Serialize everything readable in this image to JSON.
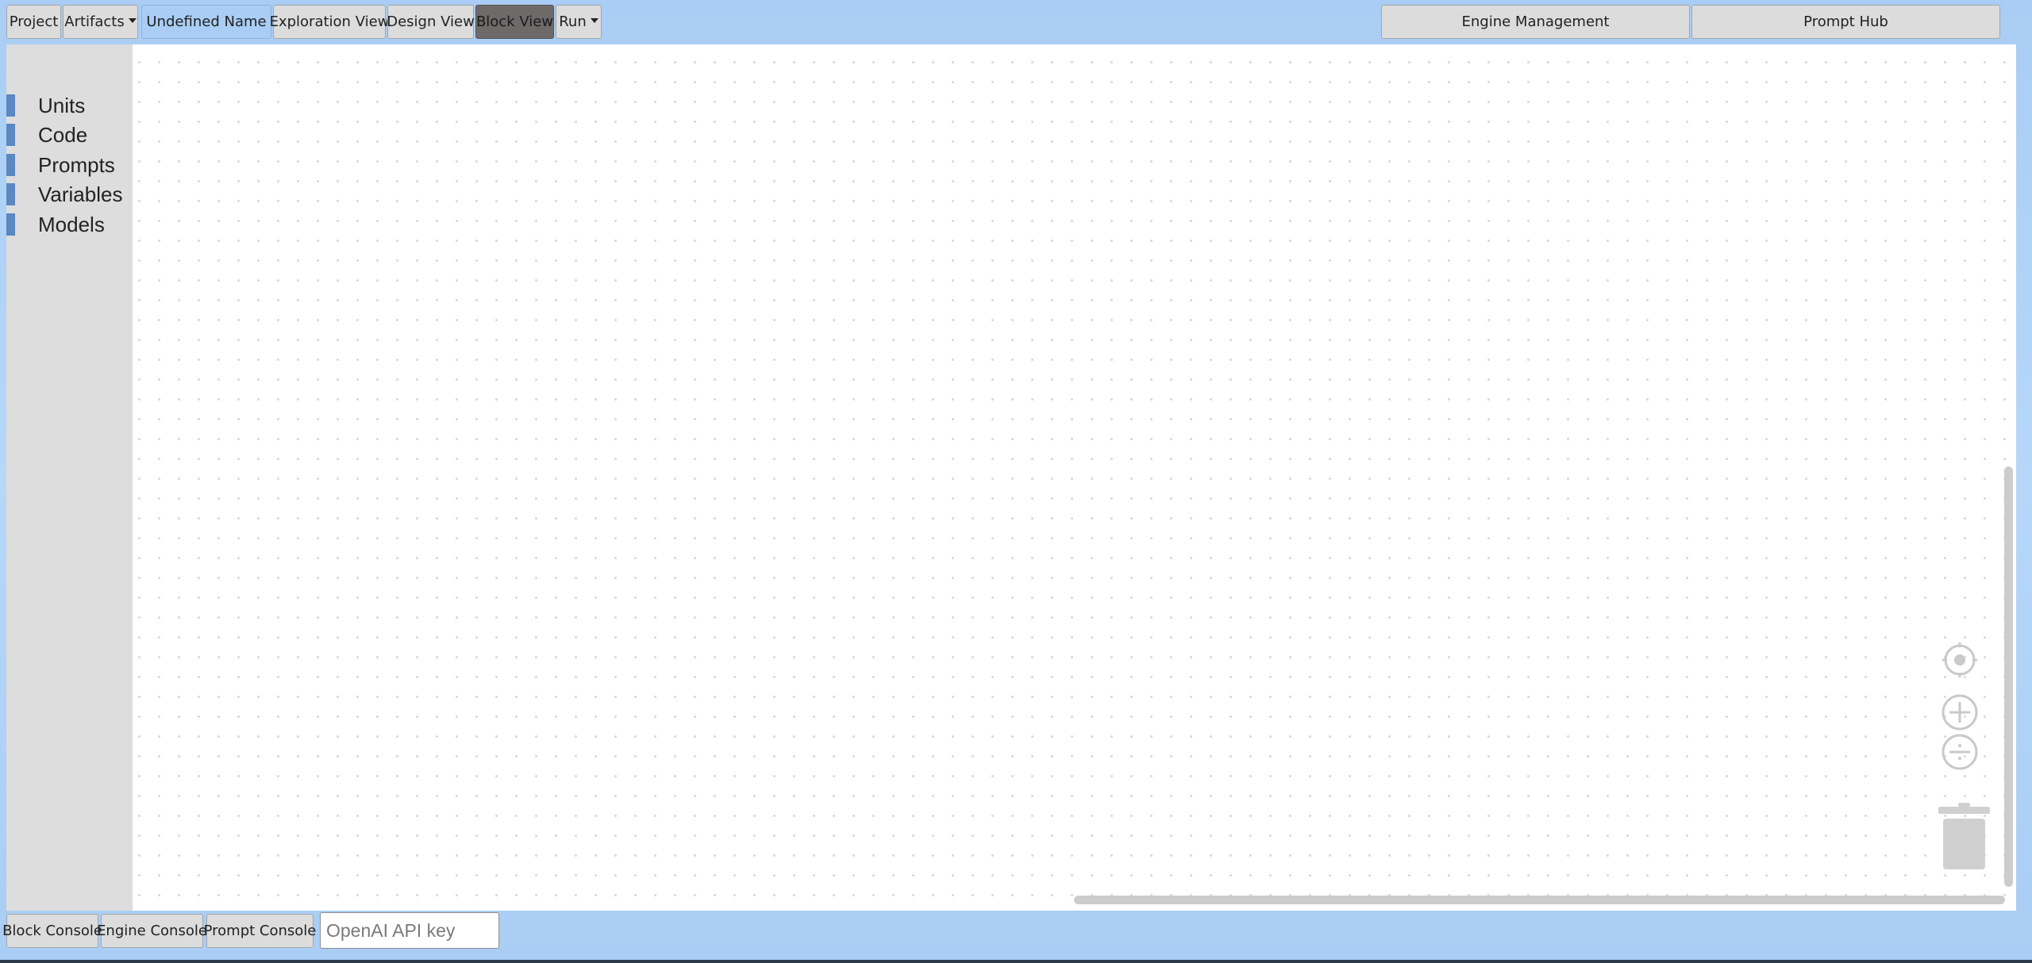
{
  "topbar": {
    "project": "Project",
    "artifacts": "Artifacts",
    "project_name": "Undefined Name",
    "exploration_view": "Exploration View",
    "design_view": "Design View",
    "block_view": "Block View",
    "run": "Run",
    "engine_management": "Engine Management",
    "prompt_hub": "Prompt Hub"
  },
  "toolbox": {
    "categories": [
      {
        "label": "Units",
        "color": "#5b87c3"
      },
      {
        "label": "Code",
        "color": "#5b87c3"
      },
      {
        "label": "Prompts",
        "color": "#5b87c3"
      },
      {
        "label": "Variables",
        "color": "#5b87c3"
      },
      {
        "label": "Models",
        "color": "#5b87c3"
      }
    ]
  },
  "canvas_controls": {
    "icons": [
      "recenter-icon",
      "zoom-in-icon",
      "zoom-out-icon",
      "trash-icon"
    ]
  },
  "bottombar": {
    "block_console": "Block Console",
    "engine_console": "Engine Console",
    "prompt_console": "Prompt Console",
    "api_key_placeholder": "OpenAI API key",
    "api_key_value": ""
  },
  "colors": {
    "background": "#a9cdf4",
    "active_tab_blue": "#a9cdf4",
    "active_tab_dark": "#6e6a6a",
    "category_bar": "#5b87c3"
  }
}
